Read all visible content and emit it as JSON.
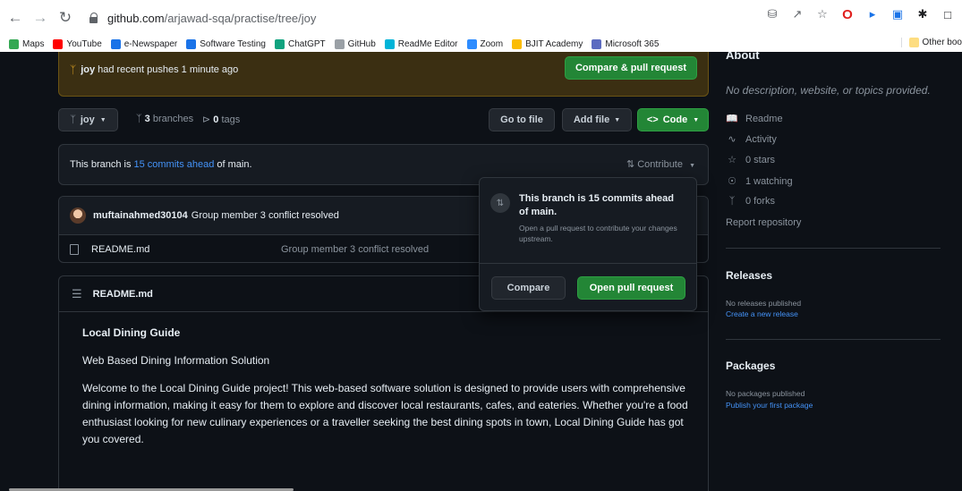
{
  "browser": {
    "url_host": "github.com",
    "url_path": "/arjawad-sqa/practise/tree/joy",
    "bookmarks": [
      {
        "label": "Maps",
        "color": "#34a853"
      },
      {
        "label": "YouTube",
        "color": "#ff0000"
      },
      {
        "label": "e-Newspaper",
        "color": "#1a73e8"
      },
      {
        "label": "Software Testing",
        "color": "#1a73e8"
      },
      {
        "label": "ChatGPT",
        "color": "#10a37f"
      },
      {
        "label": "GitHub",
        "color": "#9aa0a6"
      },
      {
        "label": "ReadMe Editor",
        "color": "#00b4d8"
      },
      {
        "label": "Zoom",
        "color": "#2d8cff"
      },
      {
        "label": "BJIT Academy",
        "color": "#fbbc04"
      },
      {
        "label": "Microsoft 365",
        "color": "#5c6bc0"
      }
    ],
    "other_bookmarks": "Other boo"
  },
  "banner": {
    "branch": "joy",
    "text": "had recent pushes 1 minute ago",
    "button": "Compare & pull request"
  },
  "toolbar": {
    "branch": "joy",
    "branches_count": "3",
    "branches_label": "branches",
    "tags_count": "0",
    "tags_label": "tags",
    "go_to_file": "Go to file",
    "add_file": "Add file",
    "code": "Code"
  },
  "ahead": {
    "prefix": "This branch is",
    "link": "15 commits ahead",
    "suffix": "of main.",
    "contribute": "Contribute"
  },
  "commit": {
    "author": "muftainahmed30104",
    "message": "Group member 3 conflict resolved"
  },
  "file": {
    "name": "README.md",
    "message": "Group member 3 conflict resolved"
  },
  "popover": {
    "title": "This branch is 15 commits ahead of main.",
    "desc": "Open a pull request to contribute your changes upstream.",
    "compare": "Compare",
    "open_pr": "Open pull request"
  },
  "readme": {
    "header": "README.md",
    "title": "Local Dining Guide",
    "subtitle": "Web Based Dining Information Solution",
    "paragraph": "Welcome to the Local Dining Guide project! This web-based software solution is designed to provide users with comprehensive dining information, making it easy for them to explore and discover local restaurants, cafes, and eateries. Whether you're a food enthusiast looking for new culinary experiences or a traveller seeking the best dining spots in town, Local Dining Guide has got you covered."
  },
  "sidebar": {
    "about": "About",
    "description": "No description, website, or topics provided.",
    "readme": "Readme",
    "activity": "Activity",
    "stars": "0 stars",
    "watching": "1 watching",
    "forks": "0 forks",
    "report": "Report repository",
    "releases": "Releases",
    "no_releases": "No releases published",
    "create_release": "Create a new release",
    "packages": "Packages",
    "no_packages": "No packages published",
    "publish_package": "Publish your first package"
  }
}
